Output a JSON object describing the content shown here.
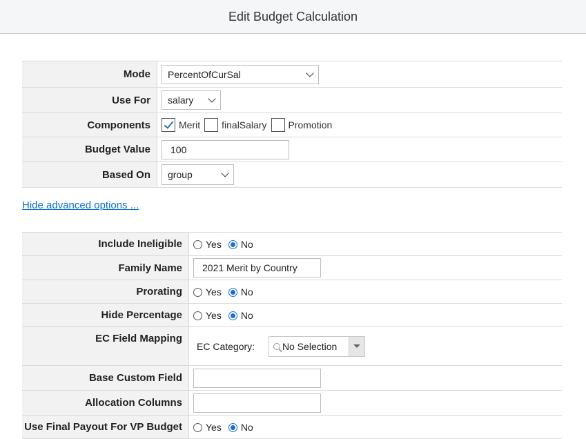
{
  "title": "Edit Budget Calculation",
  "section1": {
    "mode": {
      "label": "Mode",
      "value": "PercentOfCurSal"
    },
    "use_for": {
      "label": "Use For",
      "value": "salary"
    },
    "components": {
      "label": "Components",
      "items": [
        {
          "label": "Merit",
          "checked": true
        },
        {
          "label": "finalSalary",
          "checked": false
        },
        {
          "label": "Promotion",
          "checked": false
        }
      ]
    },
    "budget_value": {
      "label": "Budget Value",
      "value": "100"
    },
    "based_on": {
      "label": "Based On",
      "value": "group"
    }
  },
  "advanced_link": "Hide advanced options ...",
  "section2": {
    "include_ineligible": {
      "label": "Include Ineligible",
      "yes": "Yes",
      "no": "No",
      "selected": "No"
    },
    "family_name": {
      "label": "Family Name",
      "value": "2021 Merit by Country"
    },
    "prorating": {
      "label": "Prorating",
      "yes": "Yes",
      "no": "No",
      "selected": "No"
    },
    "hide_percentage": {
      "label": "Hide Percentage",
      "yes": "Yes",
      "no": "No",
      "selected": "No"
    },
    "ec_field_mapping": {
      "label": "EC Field Mapping",
      "category_label": "EC Category:",
      "value": "No Selection"
    },
    "base_custom_field": {
      "label": "Base Custom Field",
      "value": ""
    },
    "allocation_columns": {
      "label": "Allocation Columns",
      "value": ""
    },
    "use_final_payout": {
      "label": "Use Final Payout For VP Budget",
      "yes": "Yes",
      "no": "No",
      "selected": "No"
    }
  }
}
